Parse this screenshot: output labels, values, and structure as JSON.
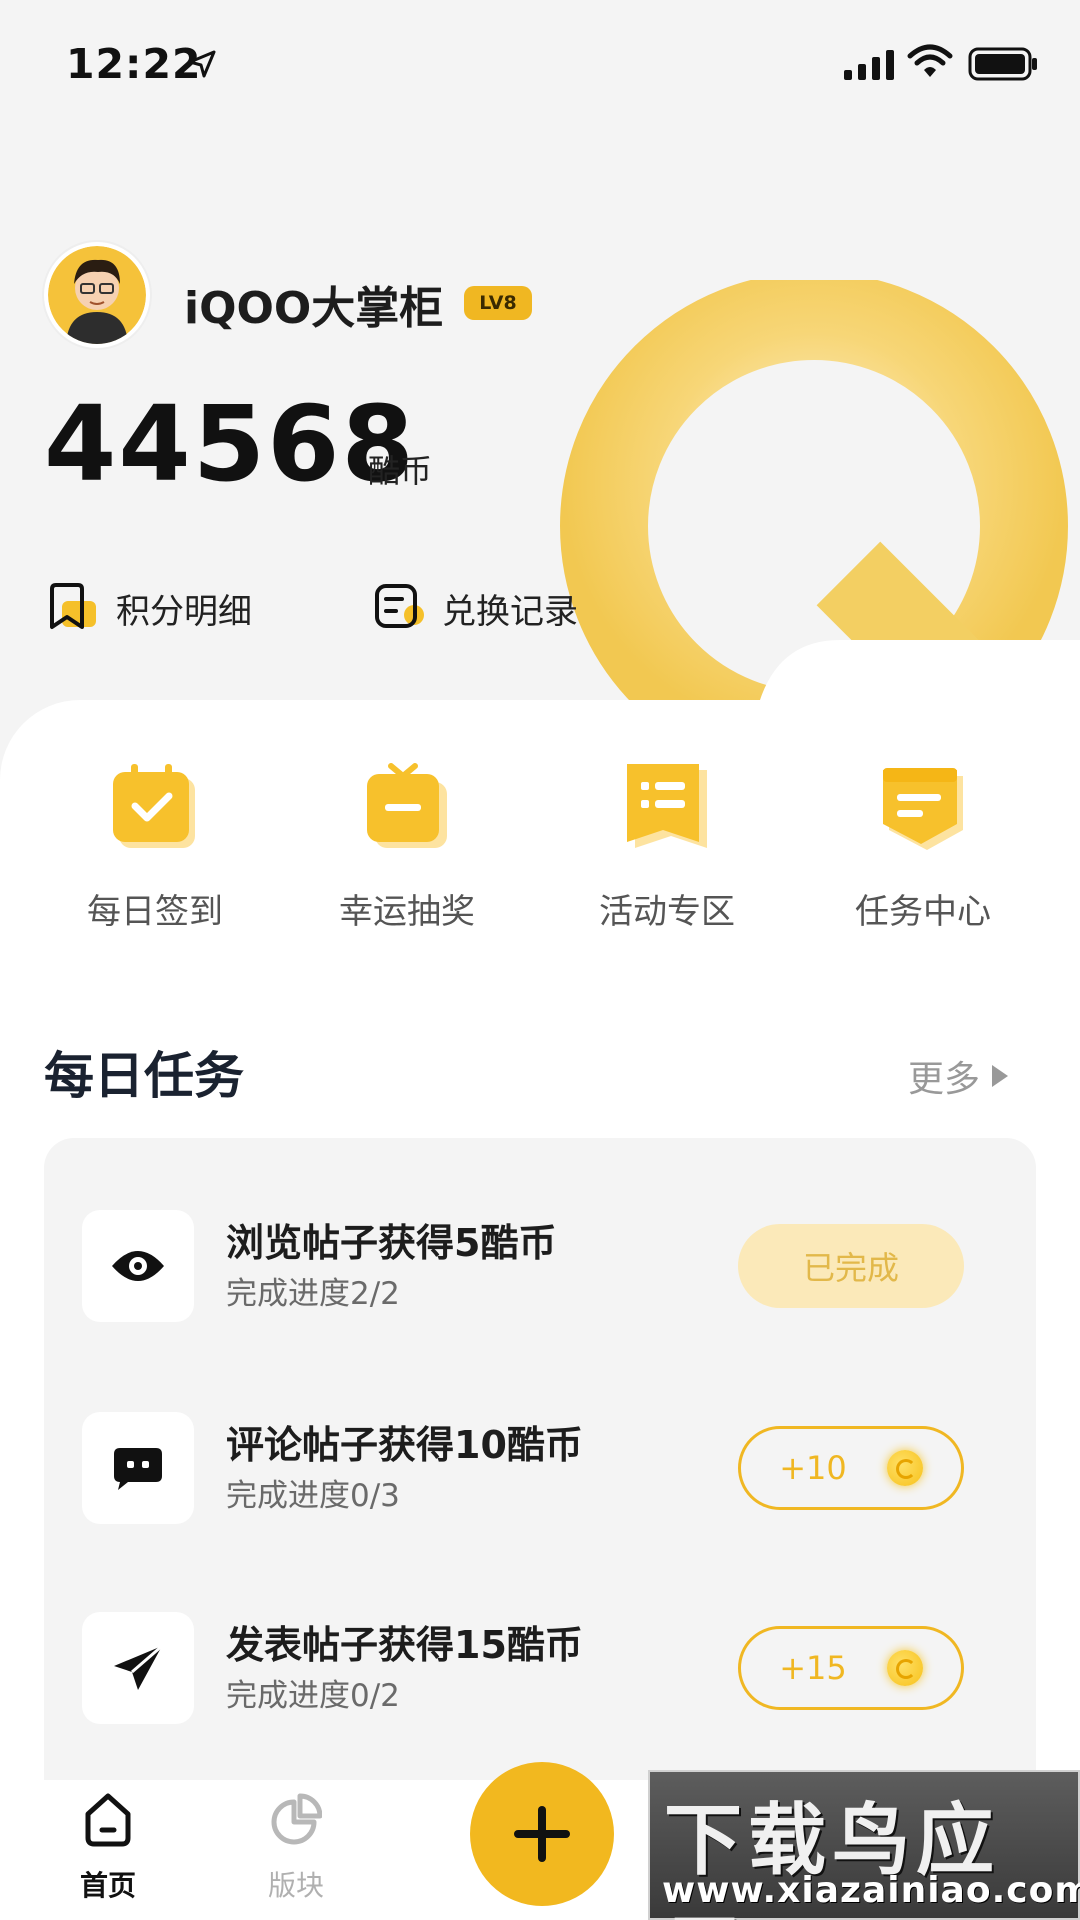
{
  "status_bar": {
    "time": "12:22"
  },
  "profile": {
    "username": "iQOO大掌柜",
    "level_badge": "LV8",
    "coins": "44568",
    "coin_unit": "酷币"
  },
  "links": [
    {
      "label": "积分明细",
      "icon": "points-detail-icon"
    },
    {
      "label": "兑换记录",
      "icon": "exchange-record-icon"
    }
  ],
  "quick_actions": [
    {
      "label": "每日签到",
      "icon": "calendar-check-icon"
    },
    {
      "label": "幸运抽奖",
      "icon": "lottery-icon"
    },
    {
      "label": "活动专区",
      "icon": "activity-list-icon"
    },
    {
      "label": "任务中心",
      "icon": "task-center-icon"
    }
  ],
  "daily_tasks": {
    "title": "每日任务",
    "more_label": "更多",
    "items": [
      {
        "title": "浏览帖子获得5酷币",
        "progress": "完成进度2/2",
        "button": "已完成",
        "icon": "eye-icon"
      },
      {
        "title": "评论帖子获得10酷币",
        "progress": "完成进度0/3",
        "button": "+10",
        "icon": "comment-icon"
      },
      {
        "title": "发表帖子获得15酷币",
        "progress": "完成进度0/2",
        "button": "+15",
        "icon": "send-icon"
      }
    ]
  },
  "bottom_nav": [
    {
      "label": "首页",
      "icon": "home-icon",
      "active": true
    },
    {
      "label": "版块",
      "icon": "pie-chart-icon",
      "active": false
    }
  ],
  "watermark": {
    "title": "下载鸟应用",
    "url": "www.xiazainiao.com"
  },
  "colors": {
    "accent": "#f0b722",
    "panel": "#ffffff",
    "background": "#f4f4f4"
  }
}
